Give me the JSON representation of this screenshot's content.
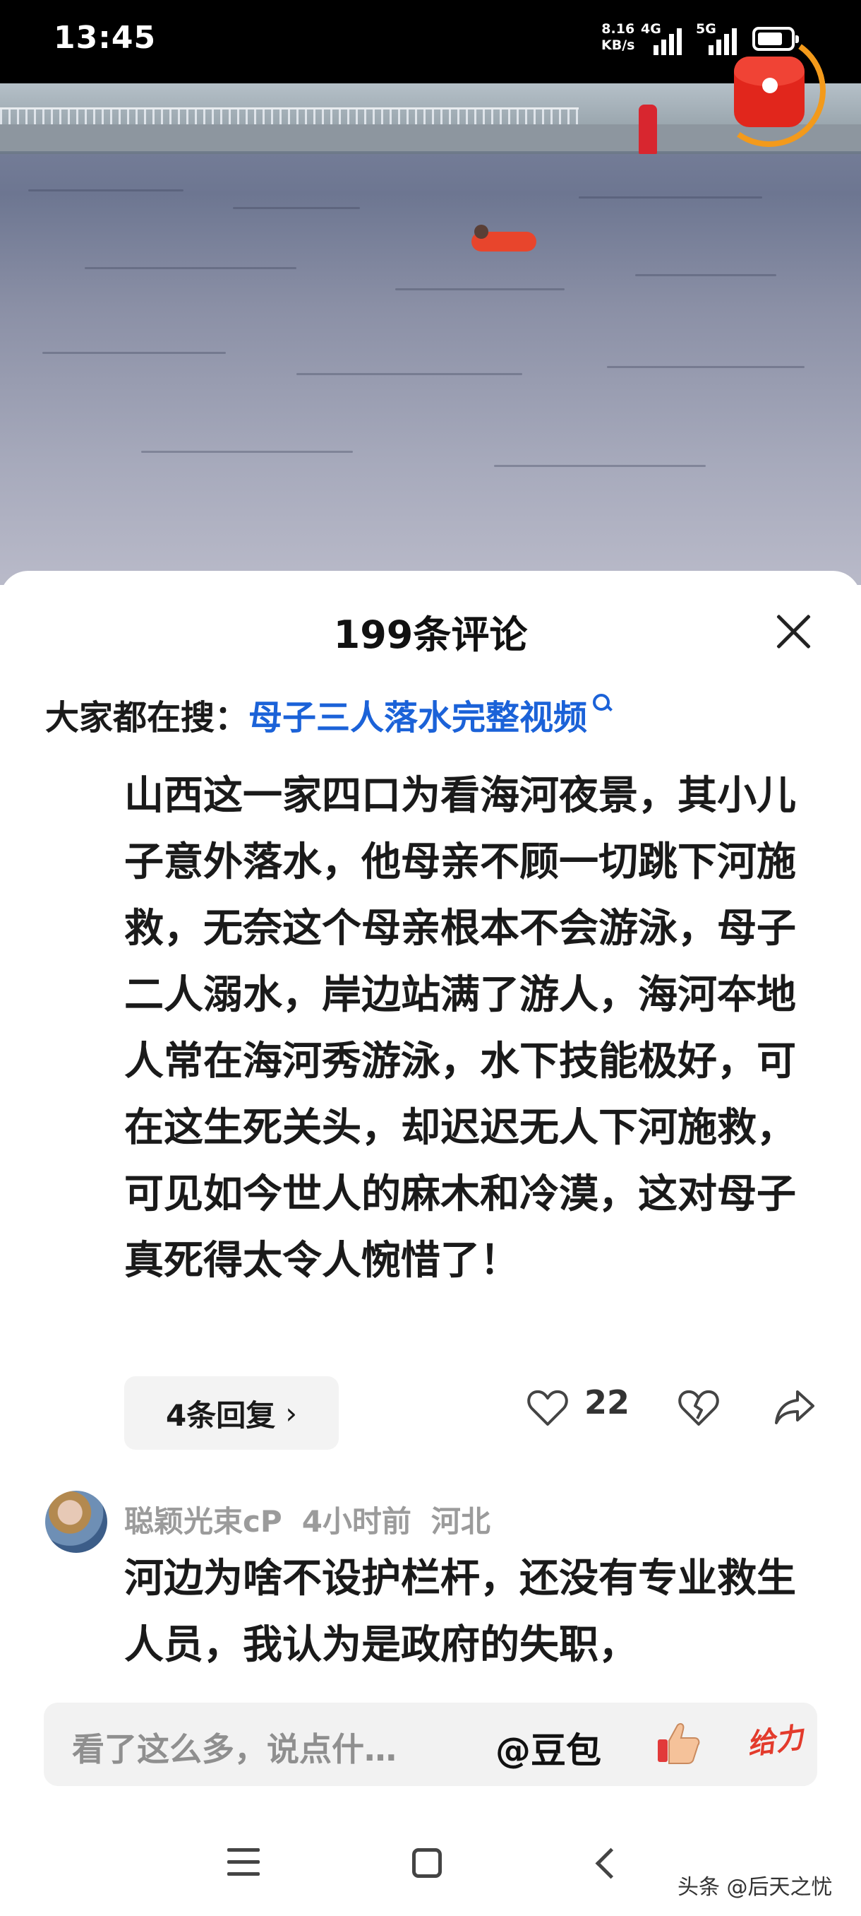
{
  "status_bar": {
    "time": "13:45",
    "net_speed_value": "8.16",
    "net_speed_unit": "KB/s",
    "signal1": "4G",
    "signal2": "5G"
  },
  "comments_panel": {
    "title": "199条评论",
    "trending_label": "大家都在搜：",
    "trending_query": "母子三人落水完整视频",
    "comments": [
      {
        "text": "山西这一家四口为看海河夜景，其小儿子意外落水，他母亲不顾一切跳下河施救，无奈这个母亲根本不会游泳，母子二人溺水，岸边站满了游人，海河夲地人常在海河秀游泳，水下技能极好，可在这生死关头，却迟迟无人下河施救，可见如今世人的麻木和冷漠，这对母子真死得太令人惋惜了！",
        "replies_label": "4条回复",
        "likes": "22"
      },
      {
        "author": "聪颖光束cP",
        "time_ago": "4小时前",
        "location": "河北",
        "text": "河边为啥不设护栏杆，还没有专业救生人员，我认为是政府的失职，"
      }
    ]
  },
  "input_bar": {
    "placeholder": "看了这么多，说点什…",
    "mention": "@豆包",
    "sticker_text": "给力"
  },
  "nav": {
    "watermark": "头条 @后天之忧"
  }
}
